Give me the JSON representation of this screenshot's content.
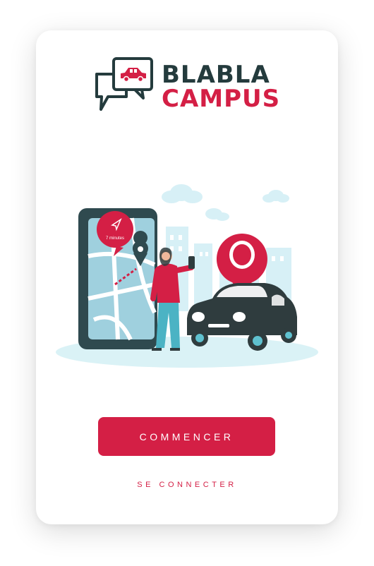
{
  "brand": {
    "line1": "BLABLA",
    "line2": "CAMPUS",
    "dark_color": "#243b3d",
    "accent_color": "#d41f45"
  },
  "illustration": {
    "bubble_text": "7 minutes"
  },
  "actions": {
    "start_label": "COMMENCER",
    "login_label": "SE CONNECTER"
  }
}
